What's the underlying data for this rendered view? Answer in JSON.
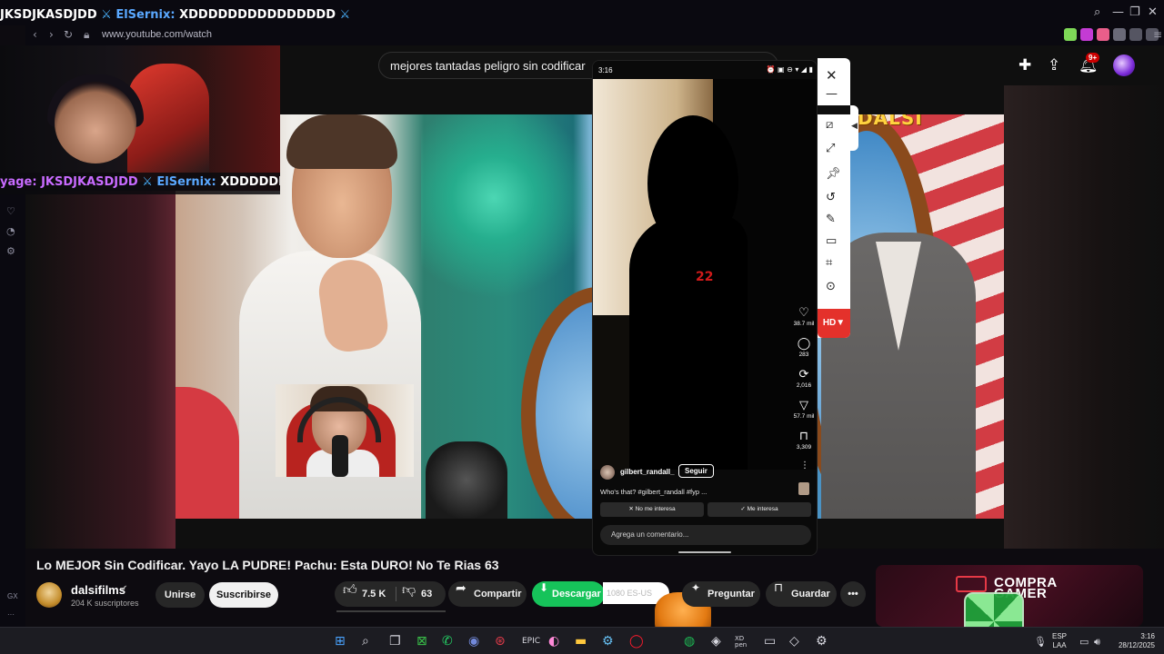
{
  "browser": {
    "url": "www.youtube.com/watch",
    "window_controls": [
      "⌕",
      "—",
      "❐",
      "✕"
    ]
  },
  "stream_overlay": {
    "chat_line_top": {
      "prefix": "JKSDJKASDJDD",
      "username": "ElSernix:",
      "message": "XDDDDDDDDDDDDDDD"
    },
    "chat_line_bottom": {
      "prefix": "yage: JKSDJKASDJDD",
      "username": "ElSernix:",
      "message": "XDDDDDDDDD"
    }
  },
  "youtube": {
    "search_query": "mejores tantadas peligro sin codificar",
    "notification_count": "9+",
    "video_title": "Lo MEJOR Sin Codificar. Yayo LA PUDRE! Pachu: Esta DURO! No Te Rias 63",
    "channel_name": "dalsifilms",
    "subscribers": "204 K suscriptores",
    "join_label": "Unirse",
    "subscribe_label": "Suscribirse",
    "likes": "7.5 K",
    "dislikes": "63",
    "share_label": "Compartir",
    "download_label": "Descargar",
    "download_ext_text": "1080  ES-US",
    "ask_label": "Preguntar",
    "save_label": "Guardar",
    "video_watermark": "DALSI",
    "ad_brand": "COMPRA GAMER"
  },
  "phone": {
    "time": "3:16",
    "status_icons": "⏰ ▣ ⊖ ▾ ◢ ▮",
    "mark_text": "22",
    "actions": [
      {
        "icon": "♡",
        "name": "like",
        "count": "38.7 mil"
      },
      {
        "icon": "◯",
        "name": "comment",
        "count": "283"
      },
      {
        "icon": "⟳",
        "name": "repost",
        "count": "2,016"
      },
      {
        "icon": "▽",
        "name": "share",
        "count": "57.7 mil"
      },
      {
        "icon": "⊓",
        "name": "bookmark",
        "count": "3,309"
      }
    ],
    "username": "gilbert_randall_",
    "follow_label": "Seguir",
    "caption": "Who's that? #gilbert_randall #fyp ...",
    "not_interested": "✕  No me interesa",
    "interested": "✓  Me interesa",
    "comment_placeholder": "Agrega un comentario..."
  },
  "phone_tools": {
    "hd_label": "HD▼"
  },
  "taskbar": {
    "lang_top": "ESP",
    "lang_bottom": "LAA",
    "clock_time": "3:16",
    "clock_date": "28/12/2025"
  },
  "sidebar": {
    "bottom_label": "GX"
  }
}
